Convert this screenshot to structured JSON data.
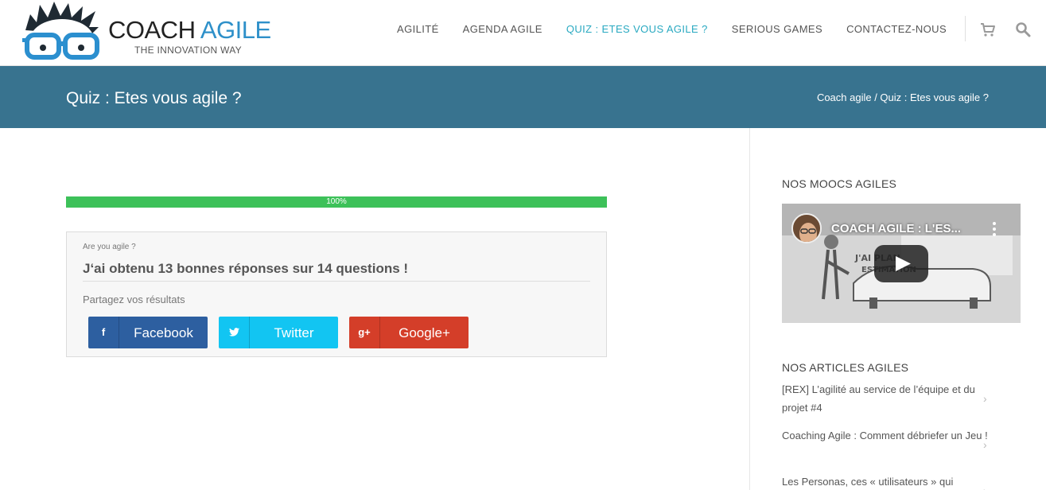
{
  "brand": {
    "name_main": "COACH ",
    "name_accent": "AGILE",
    "tagline": "THE INNOVATION WAY"
  },
  "nav": {
    "items": [
      {
        "label": "AGILITÉ",
        "active": false
      },
      {
        "label": "AGENDA AGILE",
        "active": false
      },
      {
        "label": "QUIZ : ETES VOUS AGILE ?",
        "active": true
      },
      {
        "label": "SERIOUS GAMES",
        "active": false
      },
      {
        "label": "CONTACTEZ-NOUS",
        "active": false
      }
    ],
    "cart_icon": "cart-icon",
    "search_icon": "search-icon"
  },
  "page": {
    "title": "Quiz : Etes vous agile ?",
    "breadcrumb": "Coach agile / Quiz : Etes vous agile ?"
  },
  "quiz": {
    "progress": 100,
    "progress_label": "100%",
    "name": "Are you agile ?",
    "result": "J‘ai obtenu 13 bonnes réponses sur 14 questions !",
    "share_label": "Partagez vos résultats",
    "share_buttons": [
      {
        "label": "Facebook",
        "icon": "facebook-icon",
        "glyph": "f",
        "color": "#2d5fa0"
      },
      {
        "label": "Twitter",
        "icon": "twitter-icon",
        "glyph": "",
        "color": "#12c5f2"
      },
      {
        "label": "Google+",
        "icon": "google-plus-icon",
        "glyph": "g+",
        "color": "#d43e29"
      }
    ]
  },
  "sidebar": {
    "moocs_title": "NOS MOOCS AGILES",
    "video_title": "COACH AGILE : L'ES...",
    "articles_title": "NOS ARTICLES AGILES",
    "articles": [
      "[REX] L’agilité au service de l’équipe et du projet #4",
      "Coaching Agile : Comment débriefer un Jeu !",
      "Les Personas, ces « utilisateurs » qui"
    ]
  },
  "colors": {
    "accent": "#29a9c1",
    "title_band": "#38738f",
    "progress": "#3dc159"
  }
}
